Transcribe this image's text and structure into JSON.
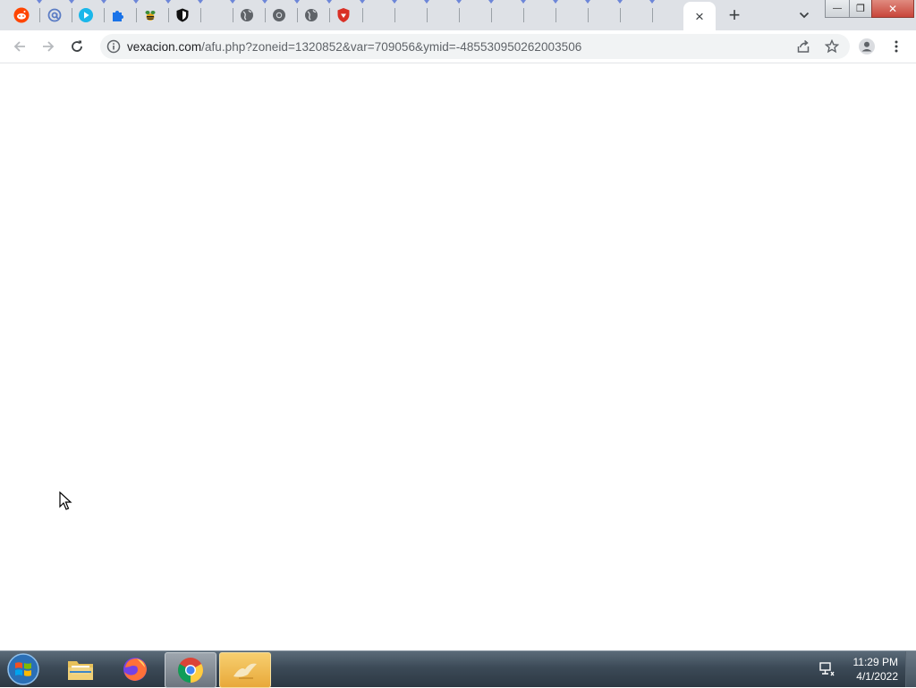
{
  "browser": {
    "tabs": [
      {
        "icon": "reddit-icon",
        "color": "#ff4500"
      },
      {
        "icon": "at-sign-icon",
        "color": "#5b7cc4"
      },
      {
        "icon": "play-icon",
        "color": "#1ab7ea"
      },
      {
        "icon": "puzzle-icon",
        "color": "#1a73e8"
      },
      {
        "icon": "bee-icon",
        "color": "#e0a51b"
      },
      {
        "icon": "shield-icon",
        "color": "#000000"
      },
      {
        "icon": "none",
        "color": ""
      },
      {
        "icon": "globe-icon",
        "color": "#5f6368"
      },
      {
        "icon": "chrome-gray-icon",
        "color": "#5f6368"
      },
      {
        "icon": "globe-icon",
        "color": "#5f6368"
      },
      {
        "icon": "red-shield-icon",
        "color": "#d93025"
      }
    ],
    "active_tab_close": "×",
    "new_tab_label": "+",
    "tab_search_icon": "chevron-down-icon",
    "window_controls": {
      "minimize": "—",
      "restore": "❐",
      "close": "✕"
    },
    "address": {
      "host": "vexacion.com",
      "path": "/afu.php?zoneid=1320852&var=709056&ymid=-485530950262003506"
    }
  },
  "taskbar": {
    "apps": [
      {
        "name": "file-explorer",
        "state": "pinned"
      },
      {
        "name": "firefox",
        "state": "pinned"
      },
      {
        "name": "chrome",
        "state": "active"
      },
      {
        "name": "unknown-app",
        "state": "highlighted"
      }
    ],
    "time": "11:29 PM",
    "date": "4/1/2022"
  }
}
